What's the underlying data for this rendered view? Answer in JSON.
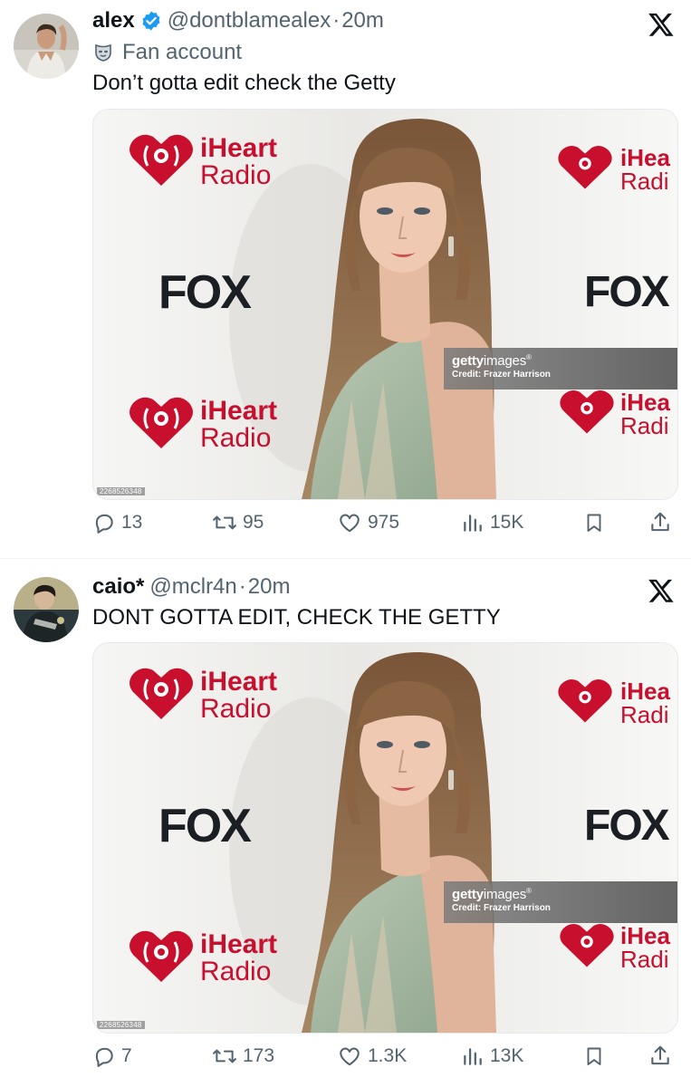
{
  "tweets": [
    {
      "author_name": "alex",
      "verified": true,
      "handle": "@dontblamealex",
      "separator": "·",
      "time": "20m",
      "label": "Fan account",
      "text": "Don’t gotta edit check the Getty",
      "media": {
        "sponsor_line1": "iHeart",
        "sponsor_line2": "Radio",
        "sponsor_crop_line1": "iHea",
        "sponsor_crop_line2": "Radi",
        "network": "FOX",
        "watermark_brand_bold": "getty",
        "watermark_brand_rest": "images",
        "watermark_reg": "®",
        "watermark_credit": "Credit: Frazer Harrison",
        "image_id": "2268526348"
      },
      "stats": {
        "replies": "13",
        "reposts": "95",
        "likes": "975",
        "views": "15K"
      }
    },
    {
      "author_name": "caio*",
      "verified": false,
      "handle": "@mclr4n",
      "separator": "·",
      "time": "20m",
      "label": "",
      "text": "DONT GOTTA EDIT, CHECK THE GETTY",
      "media": {
        "sponsor_line1": "iHeart",
        "sponsor_line2": "Radio",
        "sponsor_crop_line1": "iHea",
        "sponsor_crop_line2": "Radi",
        "network": "FOX",
        "watermark_brand_bold": "getty",
        "watermark_brand_rest": "images",
        "watermark_reg": "®",
        "watermark_credit": "Credit: Frazer Harrison",
        "image_id": "2268526348"
      },
      "stats": {
        "replies": "7",
        "reposts": "173",
        "likes": "1.3K",
        "views": "13K"
      }
    }
  ],
  "icons": {
    "verified": "verified-badge-icon",
    "label": "mask-icon",
    "platform": "x-logo-icon",
    "reply": "reply-icon",
    "repost": "repost-icon",
    "like": "like-icon",
    "views": "views-icon",
    "bookmark": "bookmark-icon",
    "share": "share-icon"
  },
  "colors": {
    "text_primary": "#0f1419",
    "text_secondary": "#536471",
    "verified_blue": "#1d9bf0",
    "iheart_red": "#c8102e",
    "divider": "#eff3f4"
  }
}
